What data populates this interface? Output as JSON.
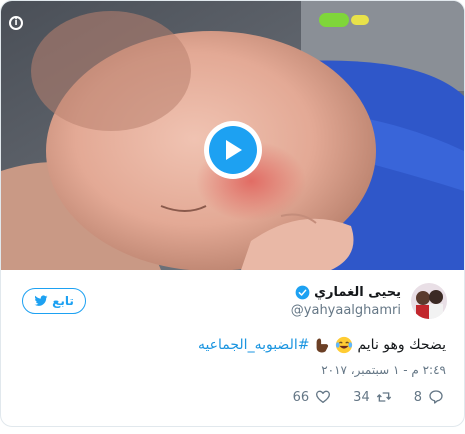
{
  "video": {
    "play_label": "Play video",
    "info_glyph": "i"
  },
  "author": {
    "display_name": "يحيى الغماري",
    "handle": "@yahyaalghamri",
    "verified": true
  },
  "follow": {
    "label": "تابع",
    "icon": "twitter-bird-icon"
  },
  "tweet": {
    "text": "يضحك وهو نايم",
    "hashtag": "#الضبوبه_الجماعيه",
    "emojis": [
      "face-with-tears-of-joy-icon",
      "pointing-hand-icon"
    ]
  },
  "timestamp": "٢:٤٩ م - ١ سبتمبر، ٢٠١٧",
  "actions": {
    "replies": "8",
    "retweets": "34",
    "likes": "66"
  },
  "colors": {
    "accent": "#1da1f2",
    "text": "#14171a",
    "muted": "#657786"
  }
}
